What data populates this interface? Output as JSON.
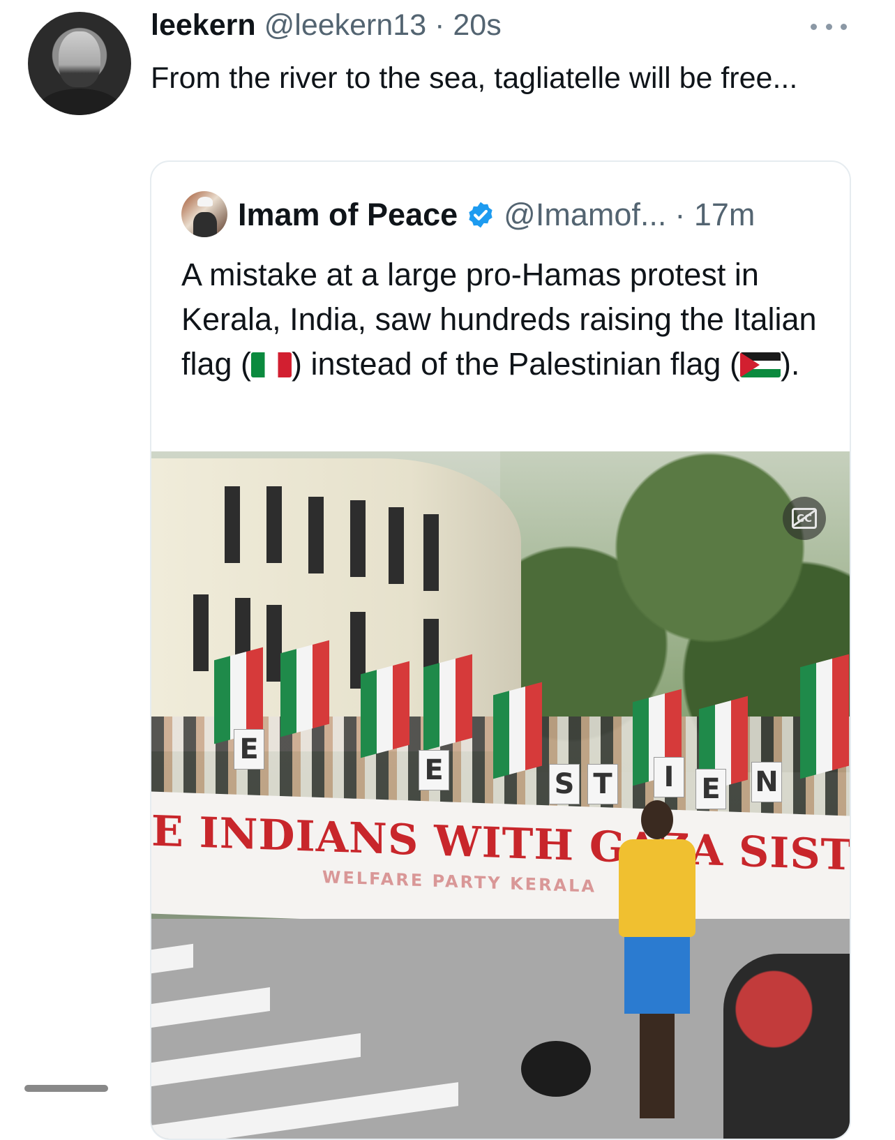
{
  "tweet": {
    "author_name": "leekern",
    "author_handle": "@leekern13",
    "time": "· 20s",
    "text": "From the river to the sea, tagliatelle will be free...",
    "more_icon": "more-horizontal-icon"
  },
  "quoted_tweet": {
    "author_name": "Imam of Peace",
    "verified": true,
    "verified_color": "#1d9bf0",
    "author_handle": "@Imamof...",
    "time": "· 17m",
    "text_part1": "A mistake at a large pro-Hamas protest in Kerala, India, saw hundreds raising the Italian flag (",
    "text_part2": ") instead of the Palestinian flag (",
    "text_part3": ").",
    "media": {
      "banner_text": "E INDIANS WITH GAZA   SIST",
      "banner_subtext": "WELFARE PARTY KERALA",
      "placard_letters": [
        "E",
        "E",
        "S",
        "T",
        "I",
        "E",
        "N"
      ],
      "captions_icon": "captions-off-icon"
    }
  }
}
